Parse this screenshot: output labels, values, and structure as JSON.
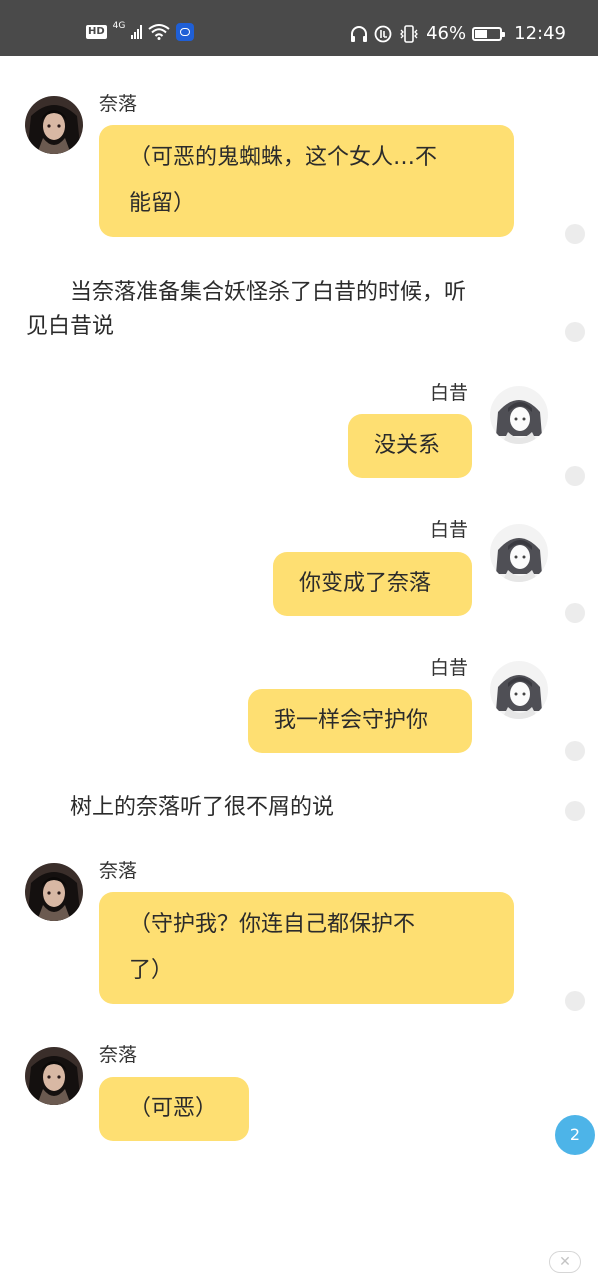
{
  "status_bar": {
    "hd": "HD",
    "network": "4G",
    "battery_percent": "46%",
    "battery_level": 0.46,
    "time": "12:49",
    "icons": [
      "hd-icon",
      "signal-icon",
      "wifi-icon",
      "app-notification-icon",
      "headphones-icon",
      "data-saver-icon",
      "vibrate-icon",
      "battery-icon"
    ]
  },
  "messages": [
    {
      "type": "left",
      "name": "奈落",
      "lines": [
        "（可恶的鬼蜘蛛，这个女人…不",
        "能留）"
      ]
    },
    {
      "type": "narration",
      "lines": [
        "　　当奈落准备集合妖怪杀了白昔的时候，听",
        "见白昔说"
      ]
    },
    {
      "type": "right",
      "name": "白昔",
      "text": "没关系"
    },
    {
      "type": "right",
      "name": "白昔",
      "text": "你变成了奈落"
    },
    {
      "type": "right",
      "name": "白昔",
      "text": "我一样会守护你"
    },
    {
      "type": "narration",
      "lines": [
        "　　树上的奈落听了很不屑的说"
      ]
    },
    {
      "type": "left",
      "name": "奈落",
      "lines": [
        "（守护我？你连自己都保护不",
        "了）"
      ]
    },
    {
      "type": "left",
      "name": "奈落",
      "lines": [
        "（可恶）"
      ]
    }
  ],
  "unread_badge": "2",
  "close_button": "✕",
  "colors": {
    "bubble": "#fedf72",
    "status_bar": "#4a4a4a",
    "badge": "#4db4e8",
    "dot": "#ececec"
  }
}
